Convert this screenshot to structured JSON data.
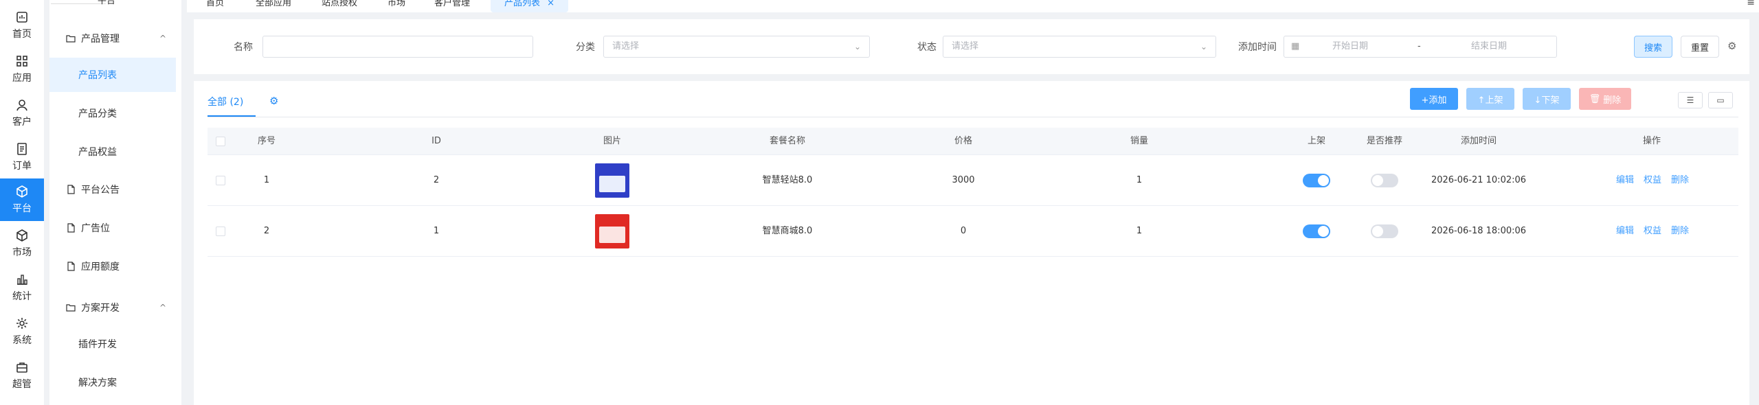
{
  "rail": {
    "items": [
      {
        "label": "首页",
        "icon": "dashboard-icon"
      },
      {
        "label": "应用",
        "icon": "apps-icon"
      },
      {
        "label": "客户",
        "icon": "user-icon"
      },
      {
        "label": "订单",
        "icon": "order-icon"
      },
      {
        "label": "平台",
        "icon": "cube-icon",
        "active": true
      },
      {
        "label": "市场",
        "icon": "box-icon"
      },
      {
        "label": "统计",
        "icon": "bar-chart-icon"
      },
      {
        "label": "系统",
        "icon": "gear-icon"
      },
      {
        "label": "超管",
        "icon": "briefcase-icon"
      }
    ]
  },
  "submenu": {
    "header": "平台",
    "groups": [
      {
        "label": "产品管理",
        "caret": "^"
      },
      {
        "label": "平台公告"
      },
      {
        "label": "广告位"
      },
      {
        "label": "应用额度"
      },
      {
        "label": "方案开发",
        "caret": "^"
      }
    ],
    "items": [
      "产品列表",
      "产品分类",
      "产品权益",
      "插件开发",
      "解决方案"
    ]
  },
  "tabs": {
    "items": [
      "首页",
      "全部应用",
      "站点授权",
      "市场",
      "客户管理"
    ],
    "active": "产品列表",
    "close": "×",
    "menu_icon": "≡"
  },
  "search": {
    "name_label": "名称",
    "category_label": "分类",
    "category_placeholder": "请选择",
    "status_label": "状态",
    "status_placeholder": "请选择",
    "time_label": "添加时间",
    "start_placeholder": "开始日期",
    "separator": "-",
    "end_placeholder": "结束日期",
    "search_button": "搜索",
    "reset_button": "重置"
  },
  "main": {
    "tab_label": "全部 (2)",
    "actions": {
      "add": "+添加",
      "up": "↑上架",
      "down": "↓下架",
      "delete": "删除"
    },
    "columns": [
      "序号",
      "ID",
      "图片",
      "套餐名称",
      "价格",
      "销量",
      "上架",
      "是否推荐",
      "添加时间",
      "操作"
    ],
    "rows": [
      {
        "index": "1",
        "id": "2",
        "image_color": "#2f3fc7",
        "name": "智慧轻站8.0",
        "price": "3000",
        "sales": "1",
        "on_shelf": true,
        "recommended": false,
        "time": "2026-06-21 10:02:06"
      },
      {
        "index": "2",
        "id": "1",
        "image_color": "#e02a24",
        "name": "智慧商城8.0",
        "price": "0",
        "sales": "1",
        "on_shelf": true,
        "recommended": false,
        "time": "2026-06-18 18:00:06"
      }
    ],
    "ops": [
      "编辑",
      "权益",
      "删除"
    ]
  },
  "colors": {
    "accent": "#1e88f5",
    "primary_button": "#409eff",
    "danger_light": "#fab6b6"
  }
}
